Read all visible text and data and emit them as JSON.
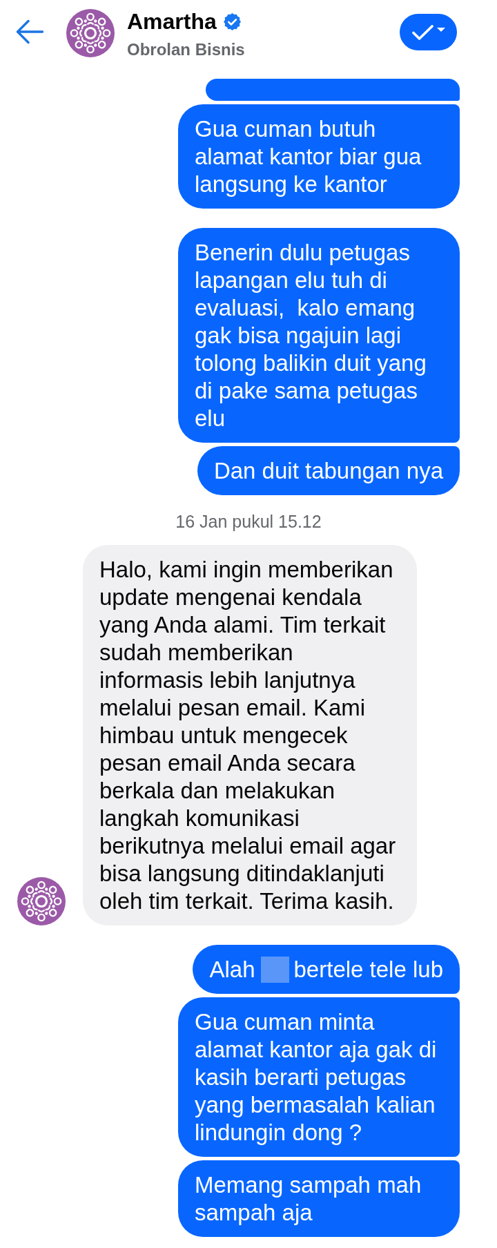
{
  "header": {
    "title": "Amartha",
    "verified": true,
    "subtitle": "Obrolan Bisnis"
  },
  "conversation": [
    {
      "kind": "sent",
      "messages": [
        {
          "kind": "clipped"
        },
        {
          "kind": "text",
          "text": "Gua cuman butuh alamat kantor biar gua langsung ke kantor"
        }
      ]
    },
    {
      "kind": "sent",
      "messages": [
        {
          "kind": "text",
          "text": "Benerin dulu petugas lapangan elu tuh di evaluasi,  kalo emang gak bisa ngajuin lagi tolong balikin duit yang di pake sama petugas elu"
        },
        {
          "kind": "text",
          "text": "Dan duit tabungan nya"
        }
      ]
    },
    {
      "kind": "timestamp",
      "text": "16 Jan pukul 15.12"
    },
    {
      "kind": "received",
      "messages": [
        {
          "kind": "text",
          "text": "Halo, kami ingin memberikan update mengenai kendala yang Anda alami. Tim terkait sudah memberikan informasis lebih lanjutnya melalui pesan email. Kami himbau untuk mengecek pesan email Anda secara berkala dan melakukan langkah komunikasi berikutnya melalui email agar bisa langsung ditindaklanjuti oleh tim terkait. Terima kasih."
        }
      ]
    },
    {
      "kind": "sent",
      "messages": [
        {
          "kind": "redacted",
          "before": "Alah",
          "after": "bertele tele lub"
        },
        {
          "kind": "text",
          "text": "Gua cuman minta alamat kantor aja gak di kasih berarti petugas yang bermasalah kalian lindungin dong ?"
        },
        {
          "kind": "text",
          "text": "Memang sampah mah sampah aja"
        }
      ]
    }
  ]
}
